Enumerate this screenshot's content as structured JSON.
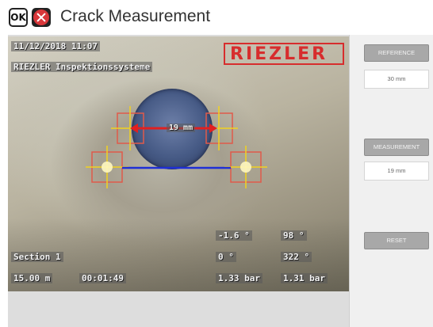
{
  "titlebar": {
    "ok_label": "OK",
    "title": "Crack Measurement"
  },
  "osd": {
    "datetime": "11/12/2018 11:07",
    "company": "RIEZLER Inspektionssysteme",
    "logo": "RIEZLER",
    "measure_label": "19 mm",
    "angle_1": "-1.6 °",
    "value_1": "98 °",
    "section": "Section 1",
    "angle_2": "0 °",
    "value_2": "322 °",
    "distance": "15.00 m",
    "elapsed": "00:01:49",
    "pressure_1": "1.33 bar",
    "pressure_2": "1.31 bar"
  },
  "sidebar": {
    "reference_label": "REFERENCE",
    "reference_value": "30 mm",
    "measurement_label": "MEASUREMENT",
    "measurement_value": "19 mm",
    "reset_label": "RESET"
  },
  "colors": {
    "measure_line": "#e02020",
    "reference_line": "#1f2fd6",
    "marker_box": "#e05a4a",
    "crosshair": "#f2d21e",
    "logo": "#d72d2d"
  }
}
